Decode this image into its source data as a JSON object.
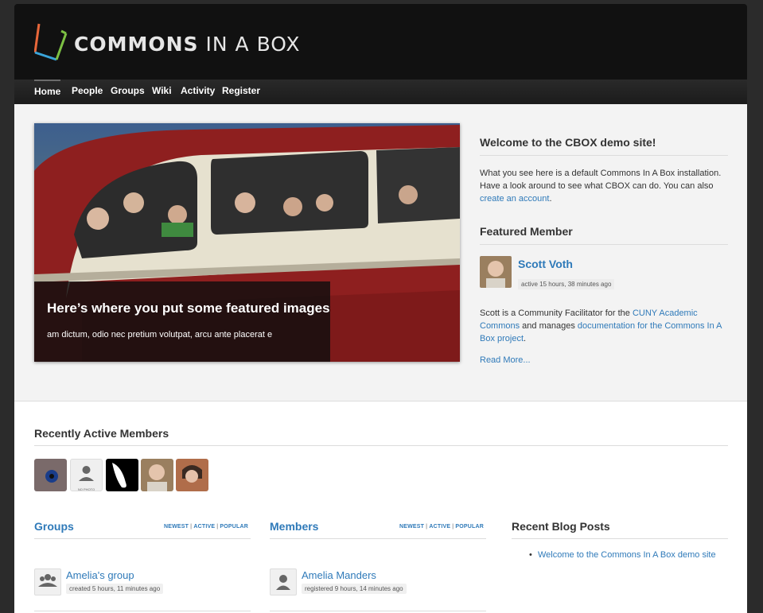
{
  "brand": {
    "logo_text_bold": "COMMONS",
    "logo_text_rest": " IN A BOX"
  },
  "nav": [
    "Home",
    "People",
    "Groups",
    "Wiki",
    "Activity",
    "Register"
  ],
  "slide": {
    "title": "Here’s where you put some featured images",
    "text": "am dictum, odio nec pretium volutpat, arcu ante placerat e"
  },
  "welcome": {
    "title": "Welcome to the CBOX demo site!",
    "text": "What you see here is a default Commons In A Box installation. Have a look around to see what CBOX can do. You can also ",
    "link": "create an account",
    "end": "."
  },
  "featured_member": {
    "title": "Featured Member",
    "name": "Scott Voth",
    "active": "active 15 hours, 38 minutes ago",
    "bio_start": "Scott is a Community Facilitator for the ",
    "bio_link1": "CUNY Academic Commons",
    "bio_mid": " and manages ",
    "bio_link2": "documentation for the Commons In A Box project",
    "bio_end": ".",
    "read_more": "Read More..."
  },
  "recent_members": {
    "title": "Recently Active Members",
    "no_photo": "NO PHOTO"
  },
  "groups": {
    "title": "Groups",
    "filters": [
      "NEWEST",
      "ACTIVE",
      "POPULAR"
    ],
    "item": {
      "name": "Amelia's group",
      "meta": "created 5 hours, 11 minutes ago"
    }
  },
  "members": {
    "title": "Members",
    "filters": [
      "NEWEST",
      "ACTIVE",
      "POPULAR"
    ],
    "item": {
      "name": "Amelia Manders",
      "meta": "registered 9 hours, 14 minutes ago"
    }
  },
  "blog": {
    "title": "Recent Blog Posts",
    "posts": [
      "Welcome to the Commons In A Box demo site"
    ]
  },
  "colors": {
    "link": "#2f7ab9",
    "header": "#111111",
    "page": "#2b2b2b"
  }
}
